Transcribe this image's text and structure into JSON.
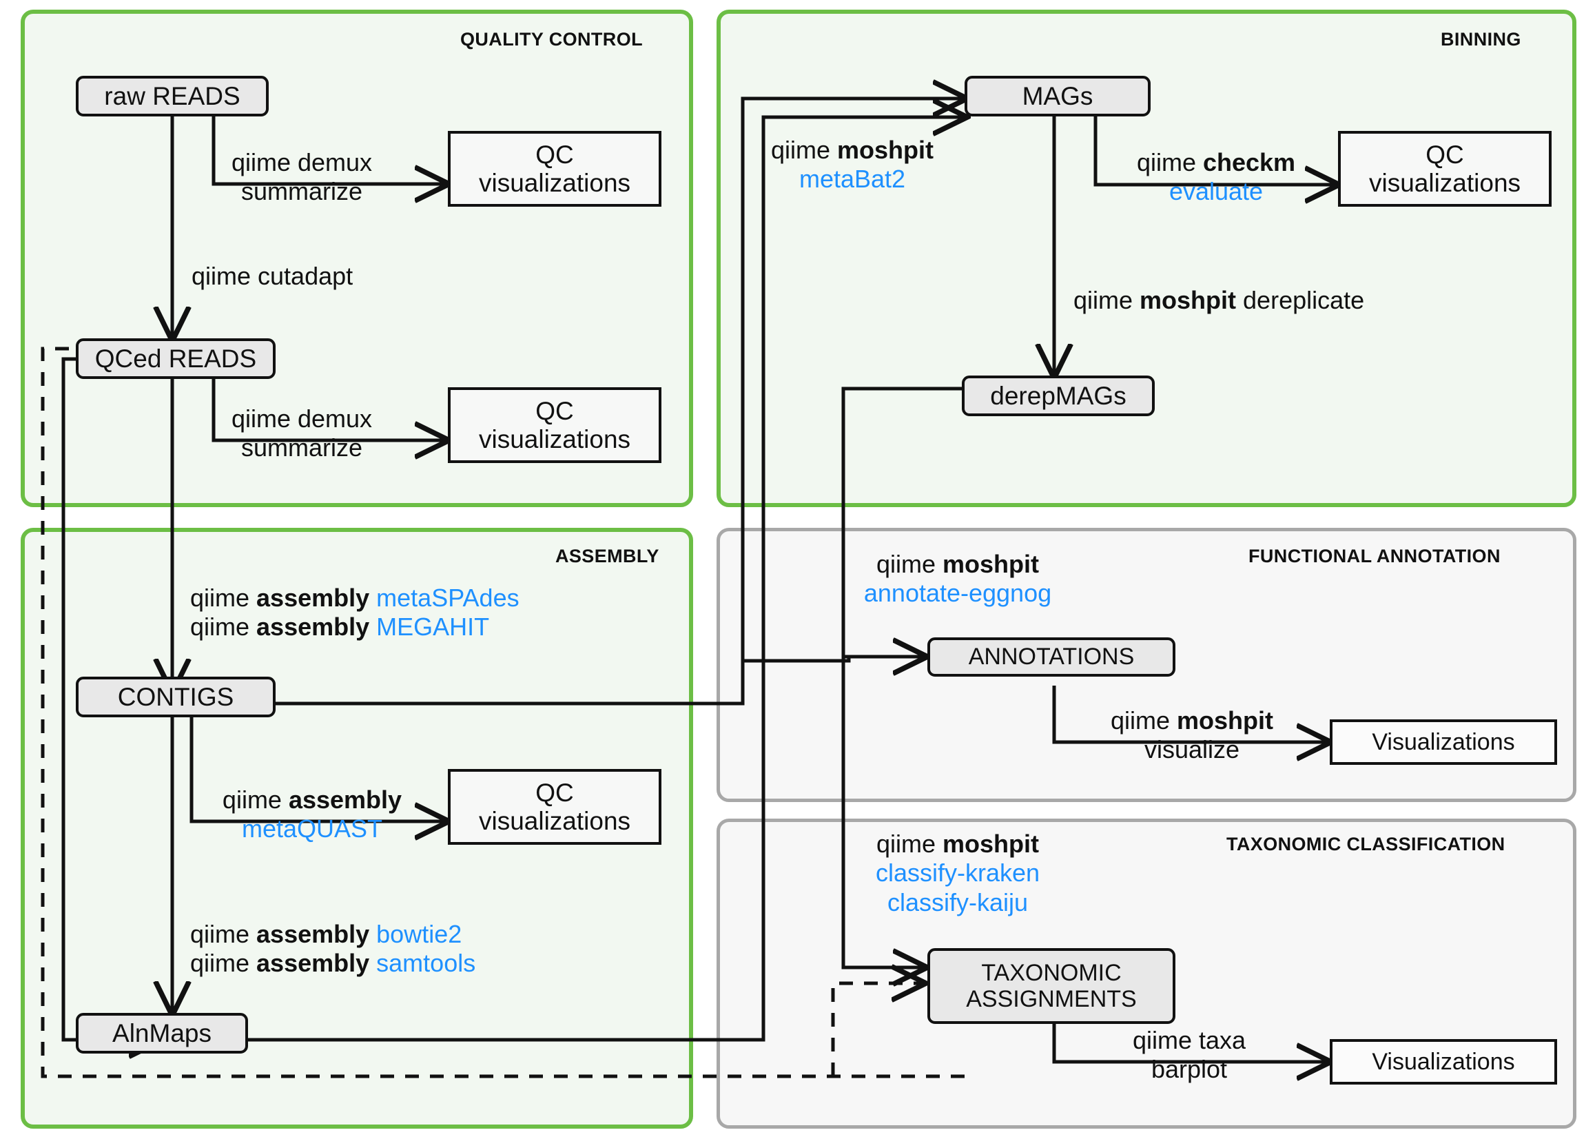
{
  "sections": [
    {
      "id": "quality_control",
      "title": "QUALITY CONTROL",
      "style": "green"
    },
    {
      "id": "binning",
      "title": "BINNING",
      "style": "green"
    },
    {
      "id": "assembly",
      "title": "ASSEMBLY",
      "style": "green"
    },
    {
      "id": "functional_annotation",
      "title": "FUNCTIONAL ANNOTATION",
      "style": "grey"
    },
    {
      "id": "taxonomic_classification",
      "title": "TAXONOMIC CLASSIFICATION",
      "style": "grey"
    }
  ],
  "colors": {
    "green_border": "#6cbe45",
    "green_fill": "#f2f8f1",
    "grey_border": "#a8a8a8",
    "grey_fill": "#f7f7f7",
    "node_fill": "#e8e8e8",
    "node_border": "#111111",
    "accent_blue": "#1e90ff",
    "text": "#111111"
  },
  "nodes": {
    "raw_reads": "raw READS",
    "qced_reads": "QCed READS",
    "qc_viz_raw_l1": "QC",
    "qc_viz_raw_l2": "visualizations",
    "qc_viz_qced_l1": "QC",
    "qc_viz_qced_l2": "visualizations",
    "mags": "MAGs",
    "derep_mags": "derepMAGs",
    "qc_viz_checkm_l1": "QC",
    "qc_viz_checkm_l2": "visualizations",
    "contigs": "CONTIGS",
    "qc_viz_quast_l1": "QC",
    "qc_viz_quast_l2": "visualizations",
    "alnmaps": "AlnMaps",
    "annotations": "ANNOTATIONS",
    "viz_annot": "Visualizations",
    "taxonomic_assignments_l1": "TAXONOMIC",
    "taxonomic_assignments_l2": "ASSIGNMENTS",
    "viz_taxa": "Visualizations"
  },
  "edge_labels": {
    "demux_raw": {
      "line1": "qiime demux",
      "line2": "summarize"
    },
    "cutadapt": {
      "line1": "qiime cutadapt"
    },
    "demux_qced": {
      "line1": "qiime demux",
      "line2": "summarize"
    },
    "metabat2": {
      "plain": "qiime ",
      "bold": "moshpit",
      "blue": "metaBat2"
    },
    "checkm": {
      "plain": "qiime ",
      "bold": "checkm",
      "blue": "evaluate"
    },
    "dereplicate": {
      "plain1": "qiime ",
      "bold": "moshpit",
      "plain2": " dereplicate"
    },
    "assembly_metaspades": {
      "plain": "qiime ",
      "bold": "assembly",
      "blue": "metaSPAdes"
    },
    "assembly_megahit": {
      "plain": "qiime ",
      "bold": "assembly",
      "blue": "MEGAHIT"
    },
    "metaquast": {
      "plain": "qiime ",
      "bold": "assembly",
      "blue": "metaQUAST"
    },
    "bowtie2": {
      "plain": "qiime ",
      "bold": "assembly",
      "blue": "bowtie2"
    },
    "samtools": {
      "plain": "qiime ",
      "bold": "assembly",
      "blue": "samtools"
    },
    "annotate_eggnog": {
      "plain": "qiime ",
      "bold": "moshpit",
      "blue": "annotate-eggnog"
    },
    "visualize": {
      "plain": "qiime ",
      "bold": "moshpit",
      "plain2": "visualize"
    },
    "classify": {
      "plain": "qiime ",
      "bold": "moshpit",
      "blue1": "classify-kraken",
      "blue2": "classify-kaiju"
    },
    "taxa_barplot": {
      "line1": "qiime taxa",
      "line2": "barplot"
    }
  }
}
